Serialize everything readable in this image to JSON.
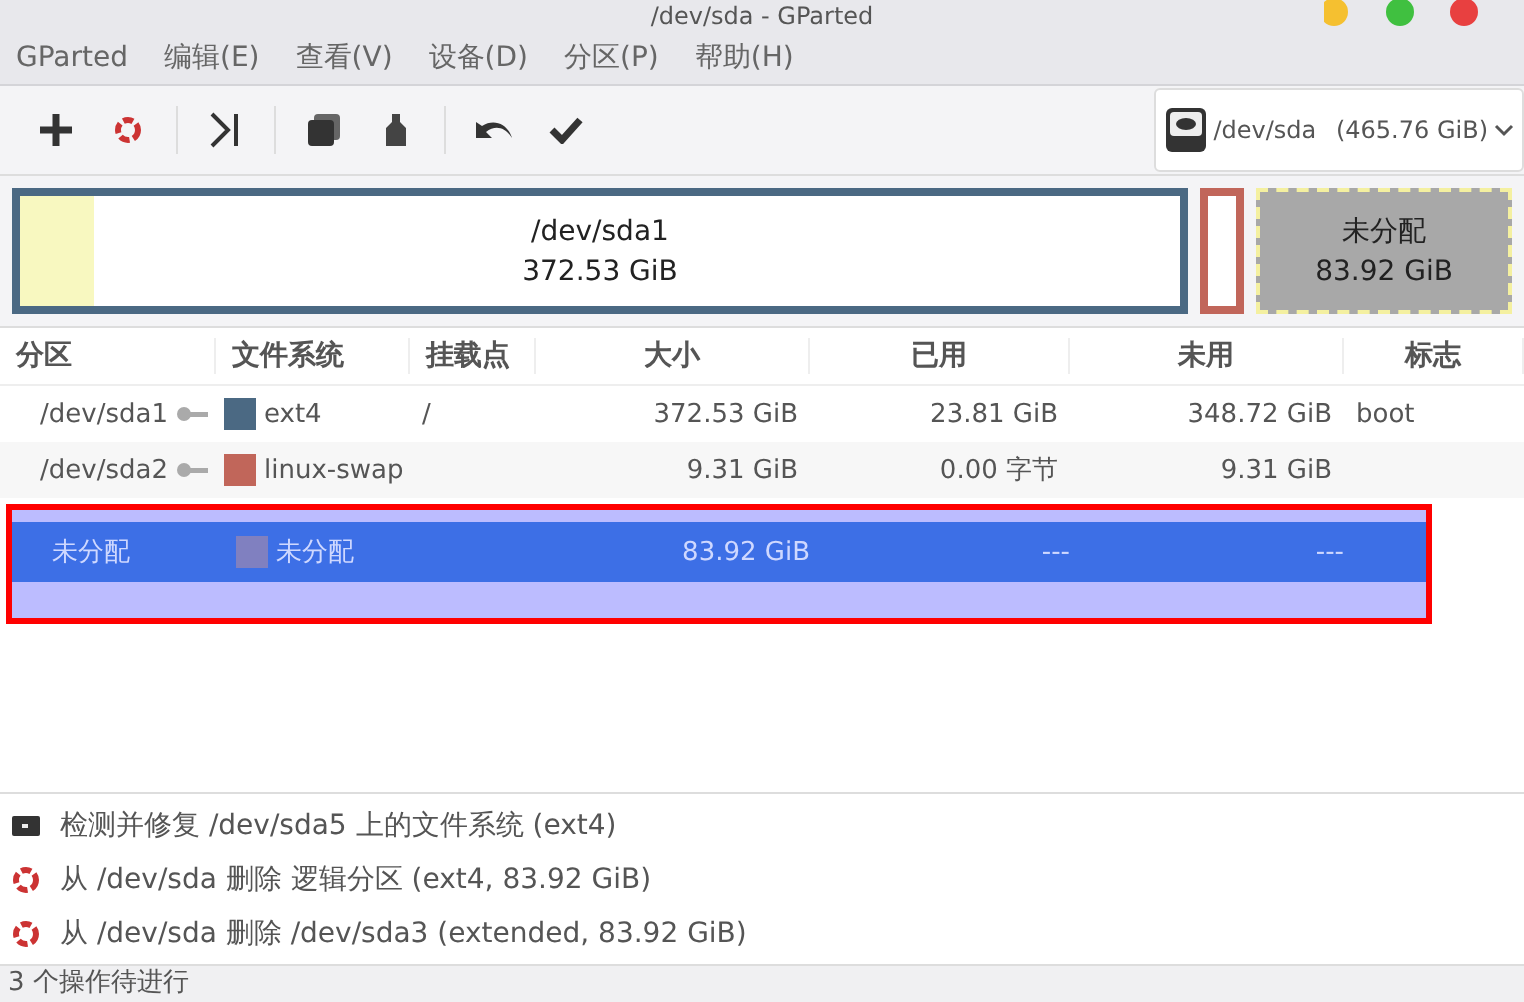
{
  "window": {
    "title": "/dev/sda - GParted"
  },
  "menu": [
    "GParted",
    "编辑(E)",
    "查看(V)",
    "设备(D)",
    "分区(P)",
    "帮助(H)"
  ],
  "device_selector": {
    "device": "/dev/sda",
    "size": "(465.76 GiB)"
  },
  "disk_map": [
    {
      "kind": "partition",
      "label": "/dev/sda1",
      "size": "372.53 GiB",
      "color": "#4b6983",
      "level": 0.064
    },
    {
      "kind": "partition",
      "color": "#c1665a"
    },
    {
      "kind": "unallocated",
      "label": "未分配",
      "size": "83.92 GiB",
      "color": "#a8a8a8"
    }
  ],
  "table": {
    "columns": [
      "分区",
      "文件系统",
      "挂载点",
      "大小",
      "已用",
      "未用",
      "标志"
    ],
    "rows": [
      {
        "partition": "/dev/sda1",
        "locked": true,
        "color": "#4b6983",
        "filesystem": "ext4",
        "mount": "/",
        "size": "372.53 GiB",
        "used": "23.81 GiB",
        "unused": "348.72 GiB",
        "flags": "boot",
        "selected": false
      },
      {
        "partition": "/dev/sda2",
        "locked": true,
        "color": "#c1665a",
        "filesystem": "linux-swap",
        "size": "9.31 GiB",
        "used": "0.00 字节",
        "unused": "9.31 GiB",
        "selected": false
      },
      {
        "partition": "未分配",
        "locked": false,
        "color": "#8080c0",
        "filesystem": "未分配",
        "size": "83.92 GiB",
        "used": "---",
        "unused": "---",
        "selected": true
      }
    ]
  },
  "operations": [
    {
      "kind": "check",
      "text": "检测并修复 /dev/sda5 上的文件系统 (ext4)"
    },
    {
      "kind": "delete",
      "text": "从 /dev/sda 删除 逻辑分区 (ext4, 83.92 GiB)"
    },
    {
      "kind": "delete",
      "text": "从 /dev/sda 删除 /dev/sda3 (extended, 83.92 GiB)"
    }
  ],
  "status_bar": "3 个操作待进行"
}
